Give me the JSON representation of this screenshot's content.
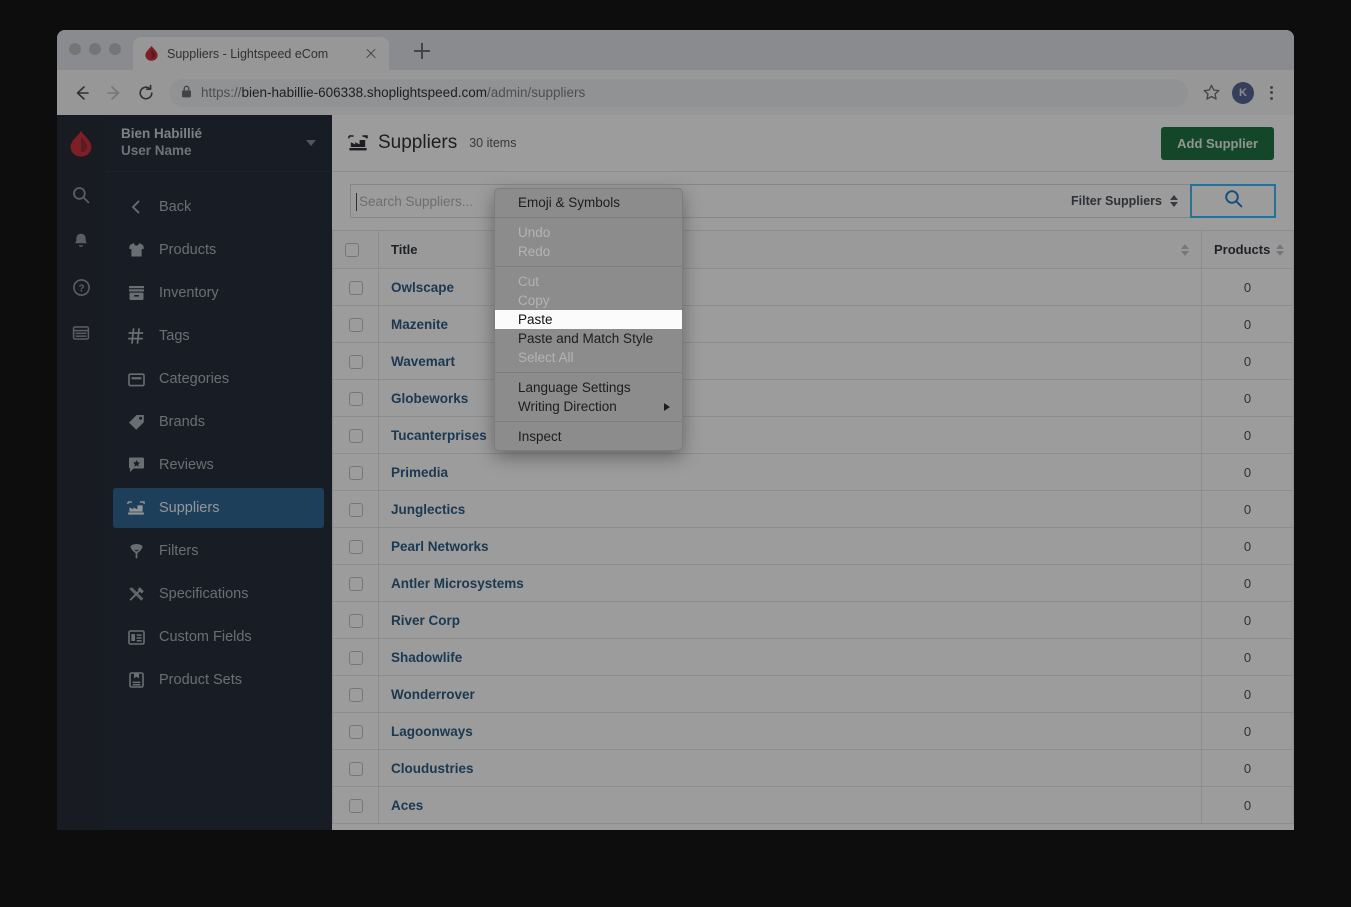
{
  "browser": {
    "tab_title": "Suppliers - Lightspeed eCom",
    "tab_favicon": "lightspeed-flame-icon",
    "new_tab_label": "+",
    "url_scheme": "https://",
    "url_host": "bien-habillie-606338.shoplightspeed.com",
    "url_path": "/admin/suppliers",
    "back_icon": "back-arrow-icon",
    "forward_icon": "forward-arrow-icon",
    "reload_icon": "reload-icon",
    "lock_icon": "lock-icon",
    "bookmark_icon": "star-icon",
    "avatar_initial": "K",
    "menu_icon": "kebab-menu-icon"
  },
  "sidebar": {
    "shop_name": "Bien Habillié",
    "user_name": "User Name",
    "rail_icons": [
      "search-icon",
      "bell-icon",
      "help-icon",
      "browser-icon"
    ],
    "items": [
      {
        "label": "Back",
        "icon": "chevron-left-icon",
        "active": false
      },
      {
        "label": "Products",
        "icon": "shirt-icon",
        "active": false
      },
      {
        "label": "Inventory",
        "icon": "inventory-icon",
        "active": false
      },
      {
        "label": "Tags",
        "icon": "hash-icon",
        "active": false
      },
      {
        "label": "Categories",
        "icon": "folder-icon",
        "active": false
      },
      {
        "label": "Brands",
        "icon": "tag-icon",
        "active": false
      },
      {
        "label": "Reviews",
        "icon": "review-star-icon",
        "active": false
      },
      {
        "label": "Suppliers",
        "icon": "suppliers-icon",
        "active": true
      },
      {
        "label": "Filters",
        "icon": "filter-icon",
        "active": false
      },
      {
        "label": "Specifications",
        "icon": "tools-icon",
        "active": false
      },
      {
        "label": "Custom Fields",
        "icon": "custom-fields-icon",
        "active": false
      },
      {
        "label": "Product Sets",
        "icon": "product-sets-icon",
        "active": false
      }
    ]
  },
  "page": {
    "icon": "suppliers-icon",
    "title": "Suppliers",
    "item_count": "30 items",
    "add_button": "Add Supplier"
  },
  "toolbar": {
    "search_placeholder": "Search Suppliers...",
    "search_value": "",
    "filter_label": "Filter Suppliers",
    "search_button_icon": "search-icon",
    "search_button_color": "#29b6f6"
  },
  "table": {
    "columns": [
      "",
      "Title",
      "Products"
    ],
    "rows": [
      {
        "title": "Owlscape",
        "products": "0"
      },
      {
        "title": "Mazenite",
        "products": "0"
      },
      {
        "title": "Wavemart",
        "products": "0"
      },
      {
        "title": "Globeworks",
        "products": "0"
      },
      {
        "title": "Tucanterprises",
        "products": "0"
      },
      {
        "title": "Primedia",
        "products": "0"
      },
      {
        "title": "Junglectics",
        "products": "0"
      },
      {
        "title": "Pearl Networks",
        "products": "0"
      },
      {
        "title": "Antler Microsystems",
        "products": "0"
      },
      {
        "title": "River Corp",
        "products": "0"
      },
      {
        "title": "Shadowlife",
        "products": "0"
      },
      {
        "title": "Wonderrover",
        "products": "0"
      },
      {
        "title": "Lagoonways",
        "products": "0"
      },
      {
        "title": "Cloudustries",
        "products": "0"
      },
      {
        "title": "Aces",
        "products": "0"
      }
    ]
  },
  "context_menu": {
    "items": [
      {
        "label": "Emoji & Symbols",
        "state": "enabled"
      },
      {
        "label": "separator",
        "state": "separator"
      },
      {
        "label": "Undo",
        "state": "disabled"
      },
      {
        "label": "Redo",
        "state": "disabled"
      },
      {
        "label": "separator",
        "state": "separator"
      },
      {
        "label": "Cut",
        "state": "disabled"
      },
      {
        "label": "Copy",
        "state": "disabled"
      },
      {
        "label": "Paste",
        "state": "highlighted"
      },
      {
        "label": "Paste and Match Style",
        "state": "enabled"
      },
      {
        "label": "Select All",
        "state": "disabled"
      },
      {
        "label": "separator",
        "state": "separator"
      },
      {
        "label": "Language Settings",
        "state": "enabled"
      },
      {
        "label": "Writing Direction",
        "state": "submenu"
      },
      {
        "label": "separator",
        "state": "separator"
      },
      {
        "label": "Inspect",
        "state": "enabled"
      }
    ]
  },
  "colors": {
    "brand_red": "#c8202c",
    "sidebar_bg": "#151c29",
    "active_nav": "#1d5a8a",
    "primary_green": "#0d6832",
    "link_blue": "#1a4f7a"
  }
}
